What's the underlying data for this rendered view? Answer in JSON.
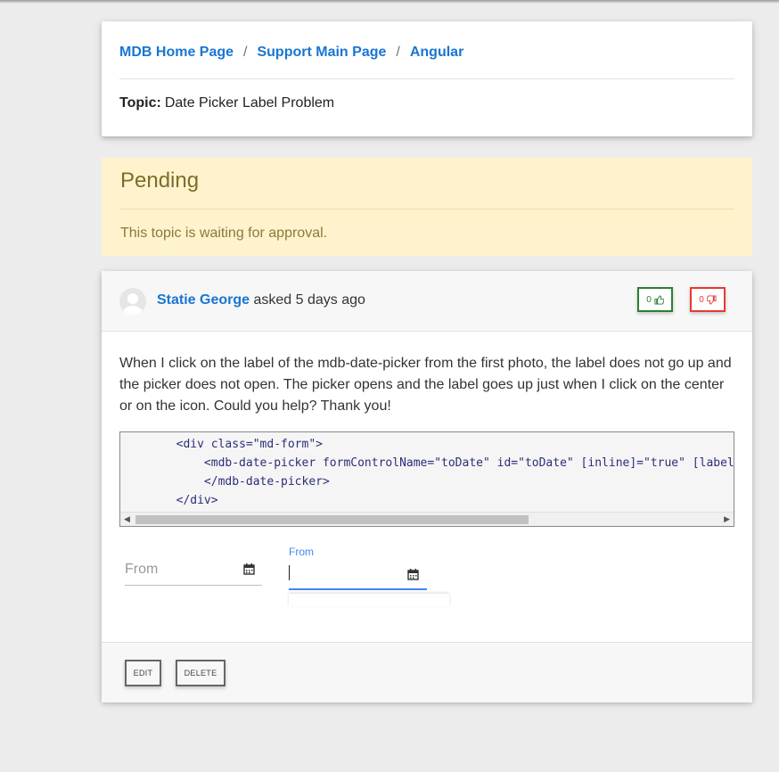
{
  "breadcrumb": {
    "items": [
      "MDB Home Page",
      "Support Main Page",
      "Angular"
    ],
    "separator": "/"
  },
  "topic": {
    "label": "Topic:",
    "title": "Date Picker Label Problem"
  },
  "status": {
    "title": "Pending",
    "message": "This topic is waiting for approval."
  },
  "post": {
    "author": "Statie George",
    "action": "asked 5 days ago",
    "upvotes": "0",
    "downvotes": "0",
    "body": "When I click on the label of the mdb-date-picker from the first photo, the label does not go up and the picker does not open. The picker opens and the label goes up just when I click on the center or on the icon. Could you help? Thank you!",
    "code_lines": [
      "<div class=\"md-form\">",
      "<mdb-date-picker formControlName=\"toDate\" id=\"toDate\" [inline]=\"true\" [label]=",
      "</mdb-date-picker>",
      "</div>"
    ],
    "picker1_label": "From",
    "picker2_label": "From"
  },
  "actions": {
    "edit": "EDIT",
    "delete": "DELETE"
  },
  "colors": {
    "link": "#1976d2",
    "pending_bg": "#fff3cd",
    "upvote": "#2e7d32",
    "downvote": "#e53935",
    "focus": "#4285f4"
  },
  "icons": [
    "thumbs-up-icon",
    "thumbs-down-icon",
    "calendar-icon",
    "avatar-icon"
  ]
}
